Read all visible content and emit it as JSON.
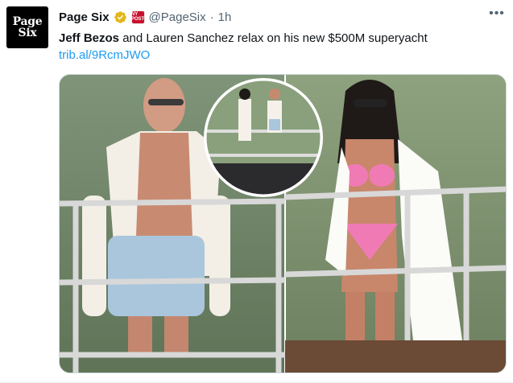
{
  "account": {
    "avatar_line1": "Page",
    "avatar_line2": "Six",
    "name": "Page Six",
    "handle": "@PageSix",
    "separator": "·",
    "time": "1h",
    "affiliate_badge_text": "NY POST"
  },
  "tweet": {
    "text_bold": "Jeff Bezos",
    "text_rest": " and Lauren Sanchez relax on his new $500M superyacht",
    "link": "trib.al/9RcmJWO"
  },
  "icons": {
    "verified": "verified-gold-check-icon",
    "more": "more-options-icon"
  },
  "colors": {
    "link": "#1d9bf0",
    "verified_gold": "#e2b719",
    "muted": "#536471",
    "text": "#0f1419"
  }
}
